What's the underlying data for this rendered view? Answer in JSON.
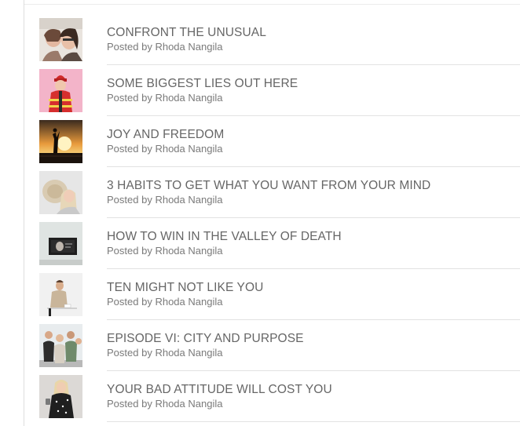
{
  "posts": [
    {
      "title": "CONFRONT THE UNUSUAL",
      "byline_prefix": "Posted by",
      "author": "Rhoda Nangila",
      "thumb_icon": "two-women-photo-icon"
    },
    {
      "title": "SOME BIGGEST LIES OUT HERE",
      "byline_prefix": "Posted by",
      "author": "Rhoda Nangila",
      "thumb_icon": "firefighter-costume-photo-icon"
    },
    {
      "title": "JOY AND FREEDOM",
      "byline_prefix": "Posted by",
      "author": "Rhoda Nangila",
      "thumb_icon": "sunset-silhouette-photo-icon"
    },
    {
      "title": "3 HABITS TO GET WHAT YOU WANT FROM YOUR MIND",
      "byline_prefix": "Posted by",
      "author": "Rhoda Nangila",
      "thumb_icon": "woman-with-hat-photo-icon"
    },
    {
      "title": "HOW TO WIN IN THE VALLEY OF DEATH",
      "byline_prefix": "Posted by",
      "author": "Rhoda Nangila",
      "thumb_icon": "framed-portrait-wall-photo-icon"
    },
    {
      "title": "TEN MIGHT NOT LIKE YOU",
      "byline_prefix": "Posted by",
      "author": "Rhoda Nangila",
      "thumb_icon": "man-at-desk-photo-icon"
    },
    {
      "title": "EPISODE VI: CITY AND PURPOSE",
      "byline_prefix": "Posted by",
      "author": "Rhoda Nangila",
      "thumb_icon": "group-of-friends-photo-icon"
    },
    {
      "title": "YOUR BAD ATTITUDE WILL COST YOU",
      "byline_prefix": "Posted by",
      "author": "Rhoda Nangila",
      "thumb_icon": "woman-in-dress-photo-icon"
    }
  ]
}
